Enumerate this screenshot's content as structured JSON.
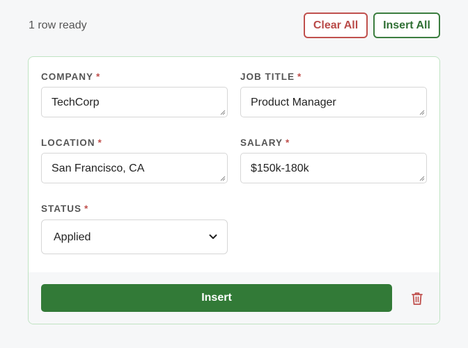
{
  "header": {
    "row_status": "1 row ready",
    "clear_all_label": "Clear All",
    "insert_all_label": "Insert All"
  },
  "form": {
    "company": {
      "label": "COMPANY",
      "value": "TechCorp"
    },
    "job_title": {
      "label": "JOB TITLE",
      "value": "Product Manager"
    },
    "location": {
      "label": "LOCATION",
      "value": "San Francisco, CA"
    },
    "salary": {
      "label": "SALARY",
      "value": "$150k-180k"
    },
    "status": {
      "label": "STATUS",
      "value": "Applied"
    },
    "required_marker": "*"
  },
  "footer": {
    "insert_label": "Insert",
    "delete_icon": "trash-icon"
  },
  "colors": {
    "accent_green": "#327a37",
    "danger_red": "#c0504d",
    "card_border": "#bfe3c2"
  }
}
